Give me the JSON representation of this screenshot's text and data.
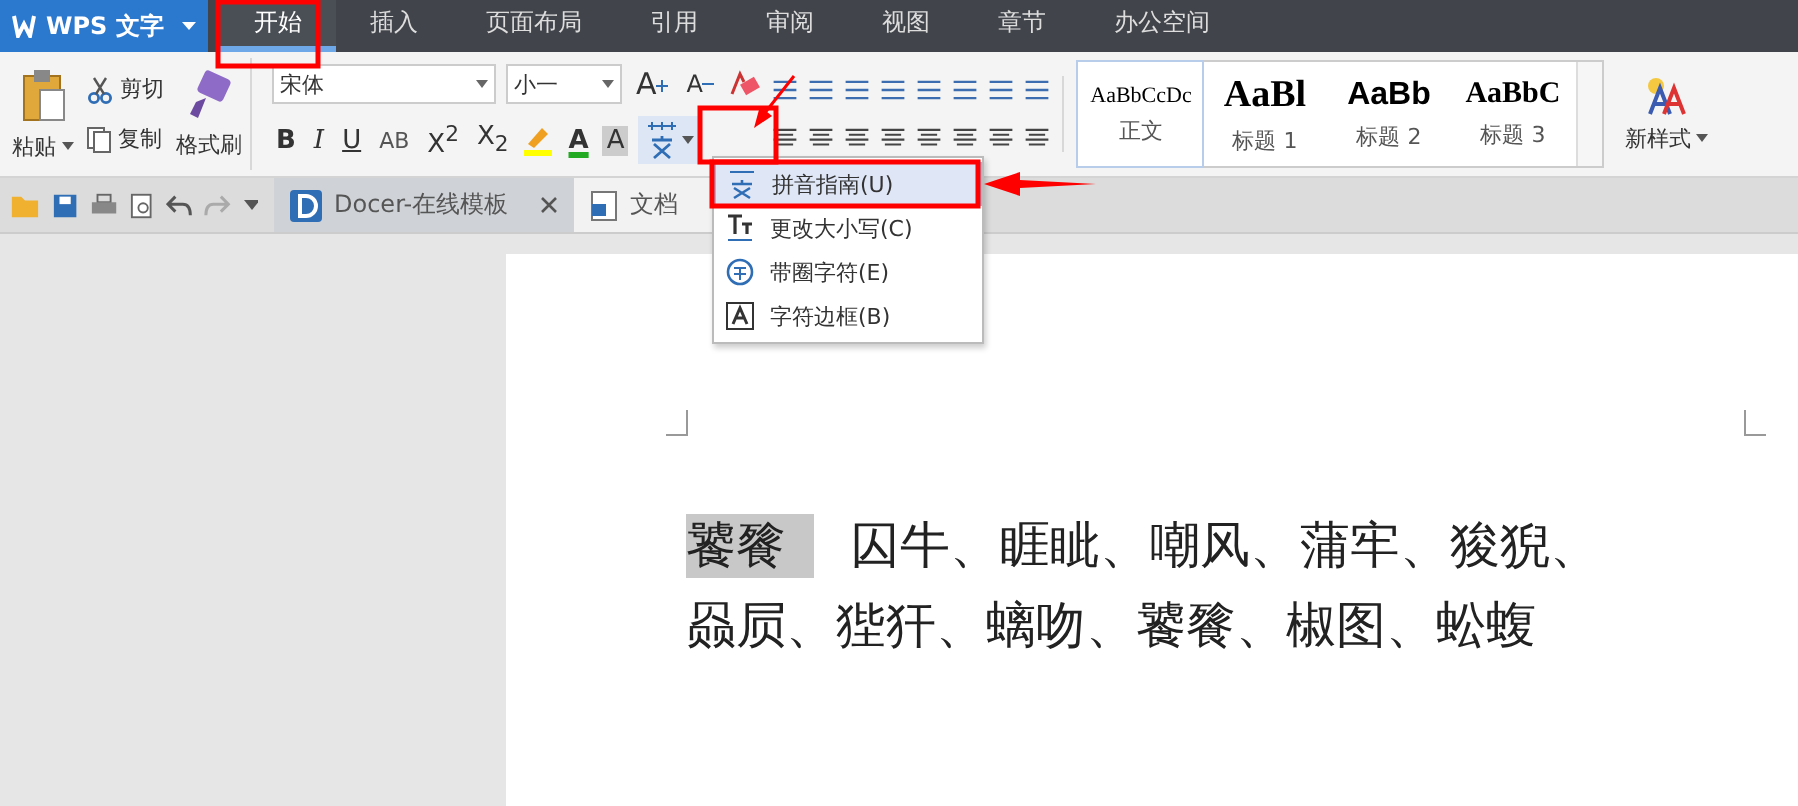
{
  "app_menu": {
    "label": "WPS 文字"
  },
  "menu_tabs": [
    {
      "label": "开始",
      "selected": true
    },
    {
      "label": "插入",
      "selected": false
    },
    {
      "label": "页面布局",
      "selected": false
    },
    {
      "label": "引用",
      "selected": false
    },
    {
      "label": "审阅",
      "selected": false
    },
    {
      "label": "视图",
      "selected": false
    },
    {
      "label": "章节",
      "selected": false
    },
    {
      "label": "办公空间",
      "selected": false
    }
  ],
  "clipboard": {
    "paste": "粘贴",
    "cut": "剪切",
    "copy": "复制",
    "format_painter": "格式刷"
  },
  "font": {
    "family": "宋体",
    "size": "小一",
    "grow": "A",
    "shrink": "A",
    "format_buttons": [
      "B",
      "I",
      "U",
      "AB",
      "X$^{2}$",
      "X$_{2}$"
    ],
    "font_color": "A",
    "shading": "A"
  },
  "styles": [
    {
      "preview": "AaBbCcDc",
      "label": "正文",
      "selected": true
    },
    {
      "preview": "AaBl",
      "label": "标题 1",
      "selected": false
    },
    {
      "preview": "AaBb",
      "label": "标题 2",
      "selected": false
    },
    {
      "preview": "AaBbC",
      "label": "标题 3",
      "selected": false
    }
  ],
  "new_style": "新样式",
  "doc_tabs": [
    {
      "label": "Docer-在线模板",
      "selected": false,
      "closable": true
    },
    {
      "label": "文档",
      "selected": true,
      "closable": false
    }
  ],
  "dropdown_menu": {
    "items": [
      {
        "label": "拼音指南(U)",
        "selected": true,
        "kind": "pinyin"
      },
      {
        "label": "更改大小写(C)",
        "selected": false,
        "kind": "case"
      },
      {
        "label": "带圈字符(E)",
        "selected": false,
        "kind": "circle"
      },
      {
        "label": "字符边框(B)",
        "selected": false,
        "kind": "border"
      }
    ]
  },
  "document": {
    "selected_text": "饕餮",
    "lines": [
      "囚牛、睚眦、嘲风、蒲牢、狻猊、",
      "赑屃、狴犴、螭吻、饕餮、椒图、蚣蝮"
    ]
  }
}
